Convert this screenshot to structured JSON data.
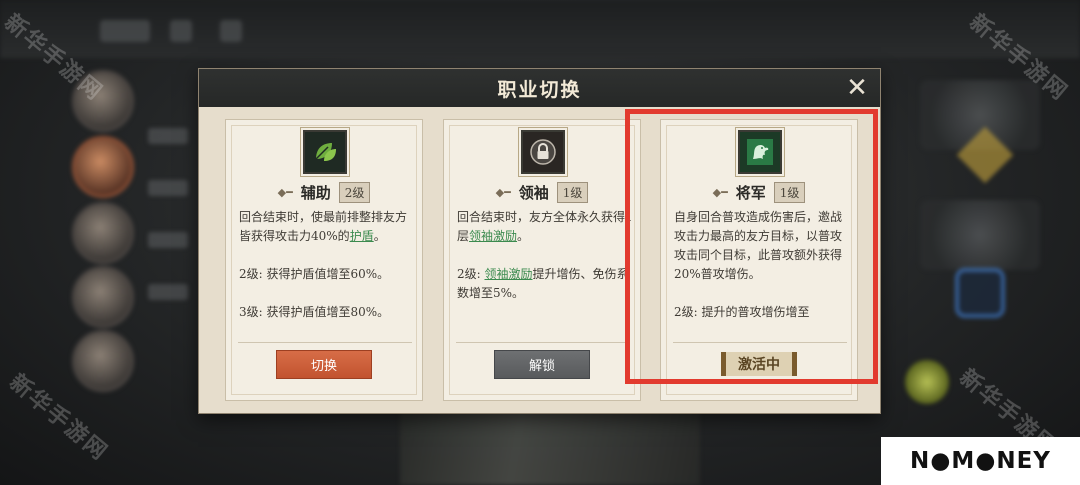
{
  "watermark": "新华手游网",
  "dialog": {
    "title": "职业切换",
    "close_glyph": "✕"
  },
  "cards": [
    {
      "name": "辅助",
      "level": "2级",
      "icon": "leaf-icon",
      "icon_color": "#5fa13a",
      "desc_lines": [
        {
          "parts": [
            {
              "t": "回合结束时，使最前排整排友方皆获得攻击力40%的"
            },
            {
              "t": "护盾",
              "hl": true
            },
            {
              "t": "。"
            }
          ]
        },
        {
          "parts": [
            {
              "t": "2级: 获得护盾值增至60%。"
            }
          ]
        },
        {
          "parts": [
            {
              "t": "3级: 获得护盾值增至80%。"
            }
          ]
        }
      ],
      "action": {
        "type": "button",
        "label": "切换",
        "style": "orange"
      }
    },
    {
      "name": "领袖",
      "level": "1级",
      "icon": "lock-icon",
      "icon_color": "#d8d8d8",
      "desc_lines": [
        {
          "parts": [
            {
              "t": "回合结束时，友方全体永久获得1层"
            },
            {
              "t": "领袖激励",
              "hl": true
            },
            {
              "t": "。"
            }
          ]
        },
        {
          "parts": [
            {
              "t": "2级: "
            },
            {
              "t": "领袖激励",
              "hl": true
            },
            {
              "t": "提升增伤、免伤系数增至5%。"
            }
          ]
        }
      ],
      "action": {
        "type": "button",
        "label": "解锁",
        "style": "gray"
      }
    },
    {
      "name": "将军",
      "level": "1级",
      "icon": "dragon-icon",
      "icon_color": "#2f8a4a",
      "desc_lines": [
        {
          "parts": [
            {
              "t": "自身回合普攻造成伤害后，邀战攻击力最高的友方目标，以普攻攻击同个目标，此普攻额外获得20%普攻增伤。"
            }
          ]
        },
        {
          "parts": [
            {
              "t": "2级: 提升的普攻增伤增至"
            }
          ]
        }
      ],
      "action": {
        "type": "tag",
        "label": "激活中"
      }
    }
  ],
  "logo": {
    "text": "N●M●NEY"
  },
  "colors": {
    "highlight": "#e23a2e",
    "accent_orange": "#c9593a"
  }
}
